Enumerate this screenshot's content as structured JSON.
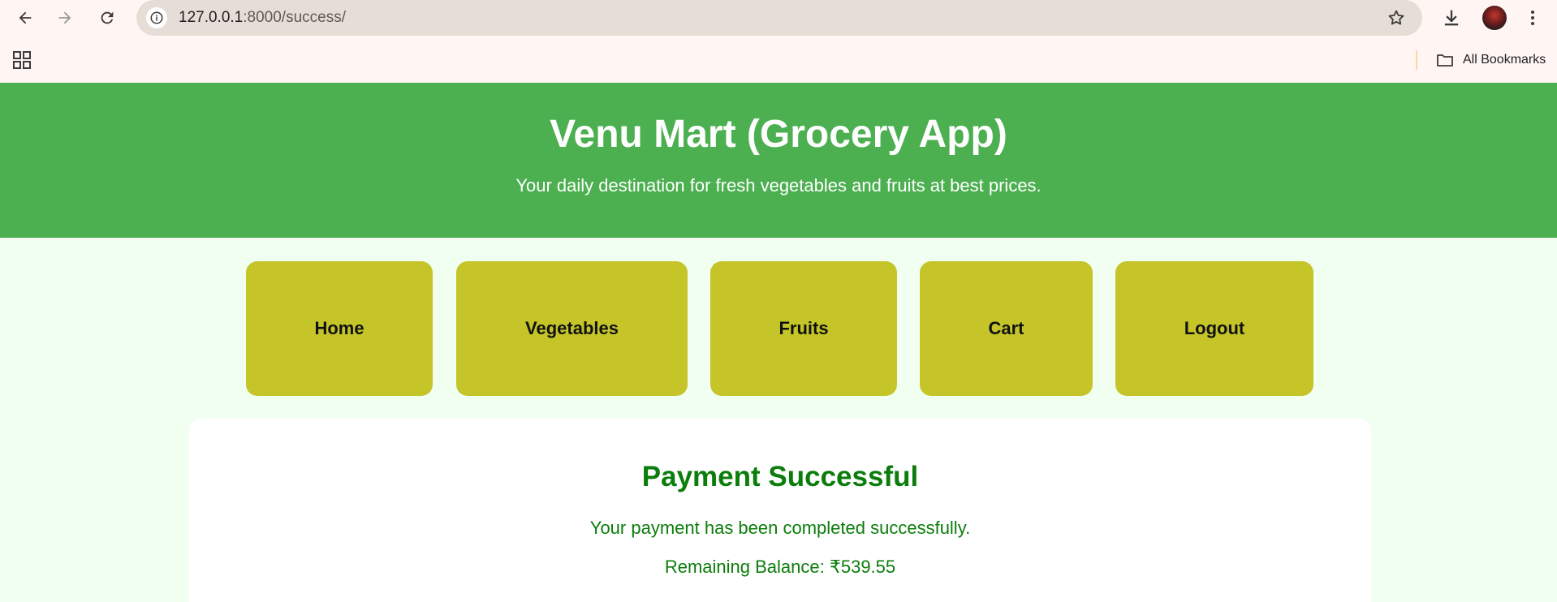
{
  "browser": {
    "url_host": "127.0.0.1",
    "url_path": ":8000/success/",
    "bookmarks_label": "All Bookmarks"
  },
  "header": {
    "title": "Venu Mart (Grocery App)",
    "tagline": "Your daily destination for fresh vegetables and fruits at best prices."
  },
  "nav": {
    "items": [
      {
        "label": "Home"
      },
      {
        "label": "Vegetables"
      },
      {
        "label": "Fruits"
      },
      {
        "label": "Cart"
      },
      {
        "label": "Logout"
      }
    ]
  },
  "card": {
    "heading": "Payment Successful",
    "message": "Your payment has been completed successfully.",
    "balance": "Remaining Balance: ₹539.55"
  },
  "colors": {
    "header_bg": "#4caf50",
    "nav_bg": "#c5c529",
    "page_bg": "#f0fff0",
    "success_text": "#0b7d0b"
  }
}
